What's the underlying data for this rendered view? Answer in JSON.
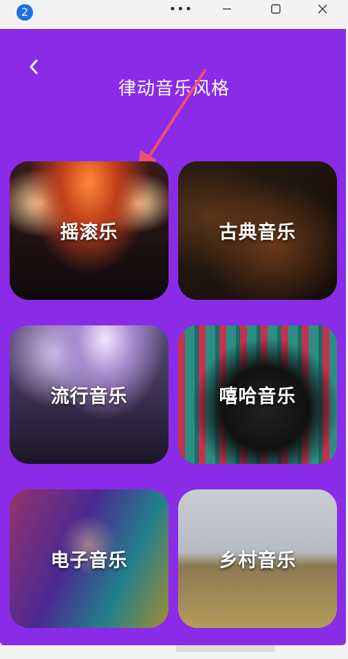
{
  "window": {
    "badge_count": "2",
    "more_glyph": "•••"
  },
  "header": {
    "title": "律动音乐风格"
  },
  "genres": [
    {
      "label": "摇滚乐"
    },
    {
      "label": "古典音乐"
    },
    {
      "label": "流行音乐"
    },
    {
      "label": "嘻哈音乐"
    },
    {
      "label": "电子音乐"
    },
    {
      "label": "乡村音乐"
    }
  ],
  "colors": {
    "app_background": "#8a2be8",
    "annotation_arrow": "#f0506e",
    "badge": "#1e6fe8"
  }
}
